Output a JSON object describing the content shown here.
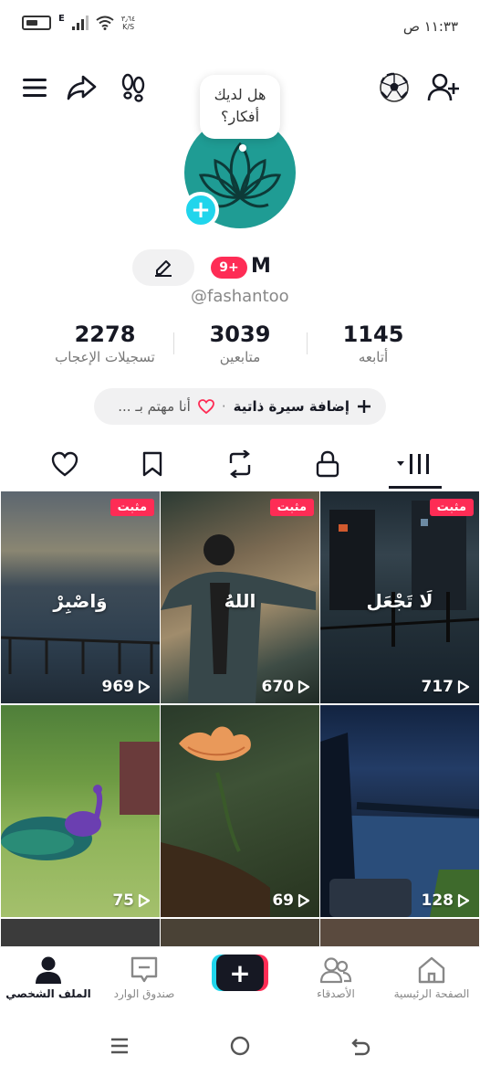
{
  "status_bar": {
    "time": "١١:٣٣ ص",
    "network_letter": "E",
    "speed_value": "٣٫٦٤",
    "speed_unit": "K/S"
  },
  "profile": {
    "thought_bubble": "هل لديك أفكار؟",
    "display_name": "M",
    "notification_badge": "9+",
    "username": "@fashantoo"
  },
  "stats": {
    "likes": {
      "value": "2278",
      "label": "تسجيلات الإعجاب"
    },
    "followers": {
      "value": "3039",
      "label": "متابعين"
    },
    "following": {
      "value": "1145",
      "label": "أتابعه"
    }
  },
  "bio": {
    "add_bio": "إضافة سيرة ذاتية",
    "separator": "·",
    "interest": "أنا مهتم بـ ..."
  },
  "videos": [
    {
      "pinned_label": "مثبت",
      "overlay": "وَاصْبِرْ",
      "views": "969"
    },
    {
      "pinned_label": "مثبت",
      "overlay": "اللهُ",
      "views": "670"
    },
    {
      "pinned_label": "مثبت",
      "overlay": "لَا تَجْعَل",
      "views": "717"
    },
    {
      "pinned_label": "",
      "overlay": "",
      "views": "75"
    },
    {
      "pinned_label": "",
      "overlay": "",
      "views": "69"
    },
    {
      "pinned_label": "",
      "overlay": "",
      "views": "128"
    }
  ],
  "bottom_nav": {
    "home": "الصفحة الرئيسية",
    "friends": "الأصدقاء",
    "create": "+",
    "inbox": "صندوق الوارد",
    "profile": "الملف الشخصي"
  },
  "colors": {
    "accent_red": "#fe2c55",
    "accent_cyan": "#20d5ec",
    "avatar_teal": "#1f9c94"
  }
}
